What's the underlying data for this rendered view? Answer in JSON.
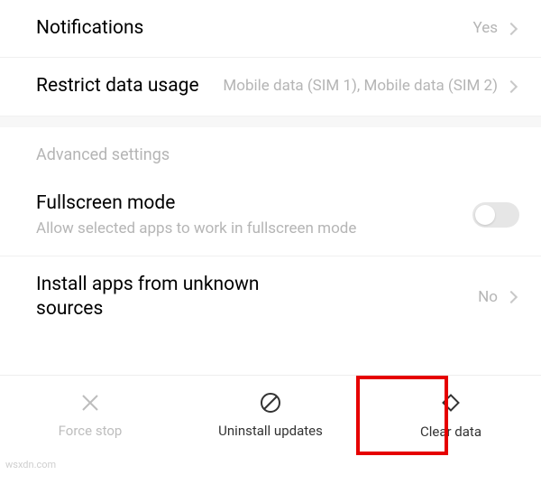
{
  "rows": {
    "notifications": {
      "title": "Notifications",
      "value": "Yes"
    },
    "restrict": {
      "title": "Restrict data usage",
      "value": "Mobile data (SIM 1), Mobile data (SIM 2)"
    },
    "fullscreen": {
      "title": "Fullscreen mode",
      "subtitle": "Allow selected apps to work in fullscreen mode"
    },
    "unknown": {
      "title": "Install apps from unknown sources",
      "value": "No"
    }
  },
  "section": {
    "advanced": "Advanced settings"
  },
  "actions": {
    "force_stop": "Force stop",
    "uninstall_updates": "Uninstall updates",
    "clear_data": "Clear data"
  },
  "watermark": "wsxdn.com"
}
